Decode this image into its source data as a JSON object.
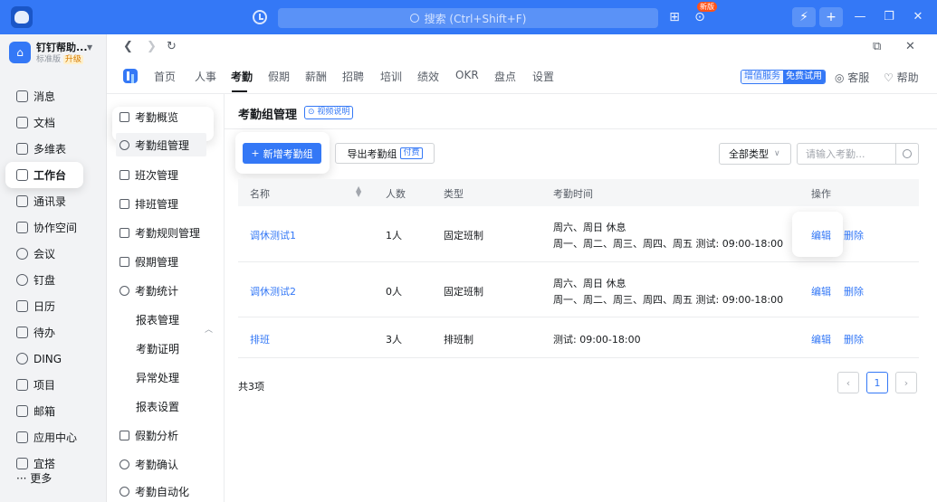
{
  "titlebar": {
    "search_placeholder": "搜索 (Ctrl+Shift+F)",
    "badge_new": "新版"
  },
  "org": {
    "name": "钉钉帮助...",
    "edition": "标准版",
    "upgrade": "升级"
  },
  "app_nav": [
    {
      "label": "消息",
      "icon": "message-icon"
    },
    {
      "label": "文档",
      "icon": "document-icon"
    },
    {
      "label": "多维表",
      "icon": "table-icon"
    },
    {
      "label": "工作台",
      "icon": "grid-icon"
    },
    {
      "label": "通讯录",
      "icon": "contacts-icon"
    },
    {
      "label": "协作空间",
      "icon": "workspace-icon"
    },
    {
      "label": "会议",
      "icon": "meeting-icon"
    },
    {
      "label": "钉盘",
      "icon": "cloud-icon"
    },
    {
      "label": "日历",
      "icon": "calendar-icon"
    },
    {
      "label": "待办",
      "icon": "todo-icon"
    },
    {
      "label": "DING",
      "icon": "ding-icon"
    },
    {
      "label": "项目",
      "icon": "project-icon"
    },
    {
      "label": "邮箱",
      "icon": "mail-icon"
    },
    {
      "label": "应用中心",
      "icon": "apps-icon"
    },
    {
      "label": "宜搭",
      "icon": "yida-icon"
    }
  ],
  "app_nav_more": "··· 更多",
  "module_tabs": [
    "首页",
    "人事",
    "考勤",
    "假期",
    "薪酬",
    "招聘",
    "培训",
    "绩效",
    "OKR",
    "盘点",
    "设置"
  ],
  "header_right": {
    "vas_label": "增值服务",
    "vas_free": "免费试用",
    "service": "客服",
    "help": "帮助"
  },
  "subnav": [
    {
      "label": "考勤概览",
      "icon": "home-icon"
    },
    {
      "label": "考勤组管理",
      "icon": "group-icon"
    },
    {
      "label": "班次管理",
      "icon": "shift-icon"
    },
    {
      "label": "排班管理",
      "icon": "schedule-icon"
    },
    {
      "label": "考勤规则管理",
      "icon": "rules-icon"
    },
    {
      "label": "假期管理",
      "icon": "holiday-icon"
    },
    {
      "label": "考勤统计",
      "icon": "stats-icon"
    },
    {
      "label": "报表管理",
      "icon": ""
    },
    {
      "label": "考勤证明",
      "icon": ""
    },
    {
      "label": "异常处理",
      "icon": ""
    },
    {
      "label": "报表设置",
      "icon": ""
    },
    {
      "label": "假勤分析",
      "icon": "chart-icon"
    },
    {
      "label": "考勤确认",
      "icon": "confirm-icon"
    },
    {
      "label": "考勤自动化",
      "icon": "auto-icon"
    }
  ],
  "content": {
    "title": "考勤组管理",
    "video_tag": "⊙ 视频说明",
    "add_button": "新增考勤组",
    "export_button": "导出考勤组",
    "paid_tag": "付费",
    "type_select": "全部类型",
    "search_placeholder": "请输入考勤..."
  },
  "table": {
    "headers": [
      "名称",
      "人数",
      "类型",
      "考勤时间",
      "操作"
    ],
    "rows": [
      {
        "name": "调休测试1",
        "count": "1人",
        "type": "固定班制",
        "time1": "周六、周日  休息",
        "time2": "周一、周二、周三、周四、周五  测试: 09:00-18:00",
        "edit": "编辑",
        "delete": "删除"
      },
      {
        "name": "调休测试2",
        "count": "0人",
        "type": "固定班制",
        "time1": "周六、周日  休息",
        "time2": "周一、周二、周三、周四、周五  测试: 09:00-18:00",
        "edit": "编辑",
        "delete": "删除"
      },
      {
        "name": "排班",
        "count": "3人",
        "type": "排班制",
        "time1": "测试: 09:00-18:00",
        "time2": "",
        "edit": "编辑",
        "delete": "删除"
      }
    ]
  },
  "pagination": {
    "total": "共3项",
    "current": "1"
  }
}
